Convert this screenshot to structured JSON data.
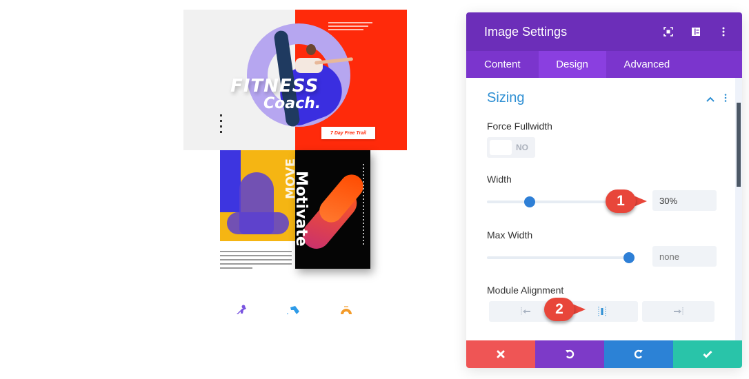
{
  "preview": {
    "hero": {
      "title_line1": "FITNESS",
      "title_line2": "Coach.",
      "cta_label": "7 Day Free Trail",
      "colors": {
        "left_bg": "#f1f1f1",
        "right_bg": "#ff2a0a",
        "ring": "#b6a6f0",
        "blob": "#3a2ee0"
      }
    },
    "second": {
      "vertical_word_left": "MOVE",
      "vertical_word_card": "Motivate",
      "colors": {
        "photo_bg": "#f5b513",
        "photo_tint": "#3d35e0",
        "card_bg": "#050505"
      }
    },
    "icon_row": [
      "person-running-icon",
      "arrow-swoosh-icon",
      "dome-icon"
    ]
  },
  "panel": {
    "title": "Image Settings",
    "header_icons": [
      "fullscreen-icon",
      "sidebar-toggle-icon",
      "more-vertical-icon"
    ],
    "tabs": [
      {
        "label": "Content",
        "active": false
      },
      {
        "label": "Design",
        "active": true
      },
      {
        "label": "Advanced",
        "active": false
      }
    ],
    "section": {
      "title": "Sizing",
      "expanded": true
    },
    "fields": {
      "force_fullwidth": {
        "label": "Force Fullwidth",
        "value": "NO",
        "on": false
      },
      "width": {
        "label": "Width",
        "value": "30%",
        "slider_fraction": 0.3
      },
      "max_width": {
        "label": "Max Width",
        "value": "",
        "placeholder": "none",
        "slider_fraction": 1.0
      },
      "module_alignment": {
        "label": "Module Alignment",
        "options": [
          "left",
          "center",
          "right"
        ],
        "selected": "center"
      }
    },
    "footer": {
      "cancel": "close-icon",
      "undo": "undo-icon",
      "redo": "redo-icon",
      "save": "check-icon"
    },
    "colors": {
      "header": "#6c2eb9",
      "tabs": "#7b35cd",
      "tab_active": "#8a3fe0",
      "accent_blue": "#2e8fd3",
      "cancel": "#ef5555",
      "undo": "#7d3ac8",
      "redo": "#2c82d6",
      "save": "#29c4a9"
    }
  },
  "annotations": [
    {
      "number": "1"
    },
    {
      "number": "2"
    }
  ]
}
